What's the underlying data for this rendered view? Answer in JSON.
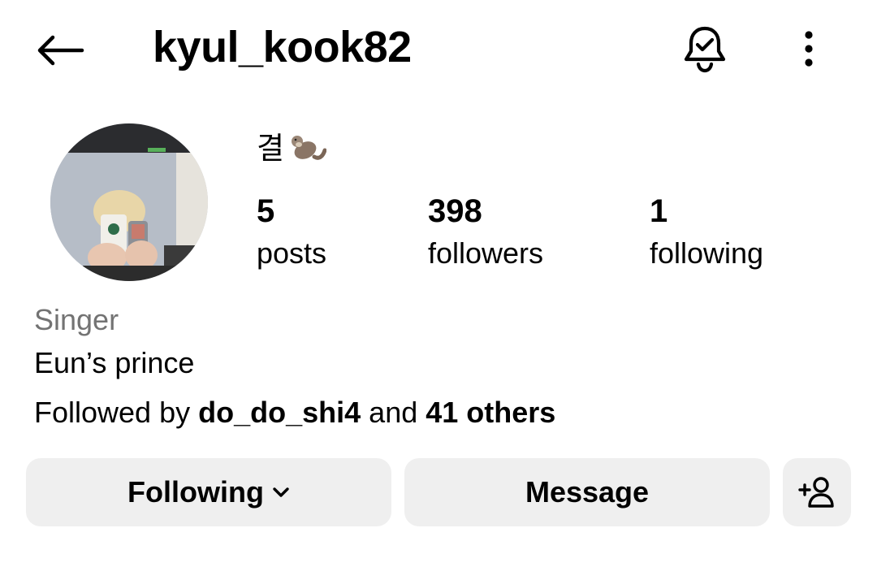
{
  "header": {
    "username": "kyul_kook82",
    "icons": {
      "back": "arrow-left-icon",
      "notifications": "bell-check-icon",
      "more": "more-vertical-icon"
    }
  },
  "profile": {
    "display_name": "결",
    "display_emoji": "otter-emoji",
    "stats": [
      {
        "value": "5",
        "label": "posts"
      },
      {
        "value": "398",
        "label": "followers"
      },
      {
        "value": "1",
        "label": "following"
      }
    ],
    "category": "Singer",
    "bio": "Eun’s prince",
    "followed_by": {
      "prefix": "Followed by",
      "user": "do_do_shi4",
      "connector": "and",
      "others": "41 others"
    }
  },
  "actions": {
    "following_label": "Following",
    "message_label": "Message",
    "add_user_icon": "add-person-icon"
  },
  "colors": {
    "button_bg": "#efefef",
    "muted_text": "#737373",
    "text": "#000000"
  }
}
